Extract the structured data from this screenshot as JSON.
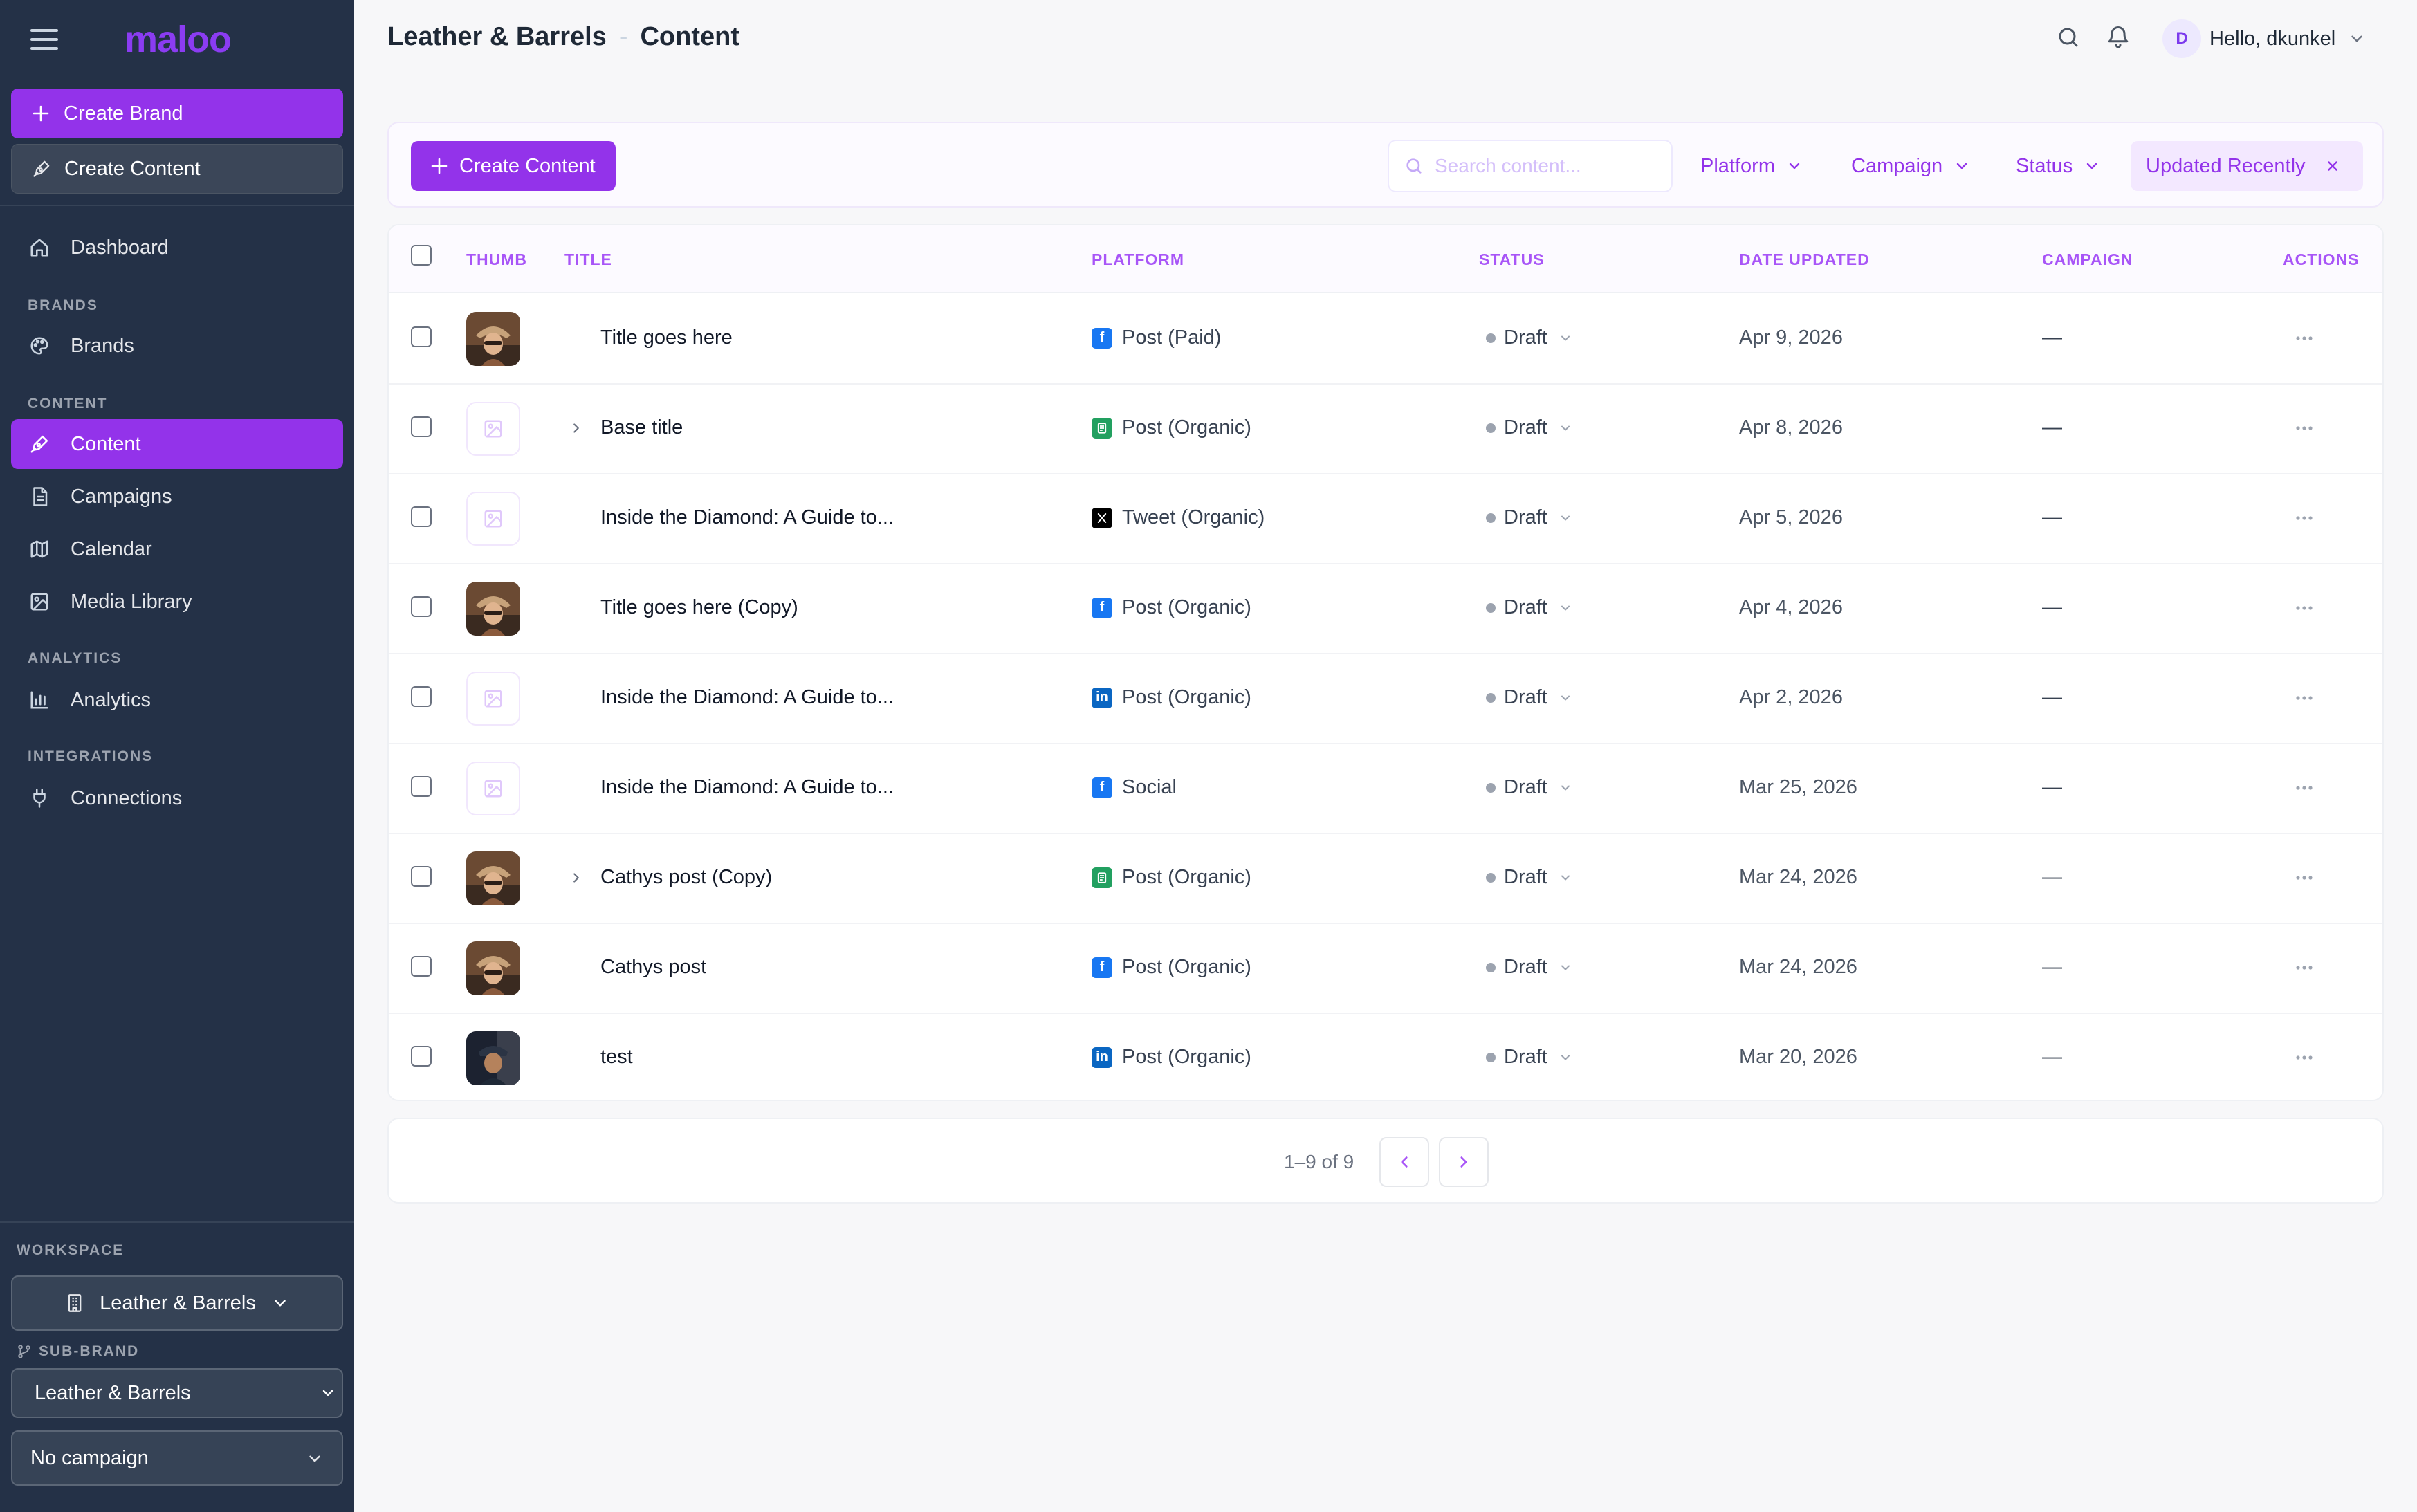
{
  "sidebar": {
    "logo": "maloo",
    "create_brand": "Create Brand",
    "create_content": "Create Content",
    "dashboard": "Dashboard",
    "section_brands": "BRANDS",
    "brands": "Brands",
    "section_content": "CONTENT",
    "content": "Content",
    "campaigns": "Campaigns",
    "calendar": "Calendar",
    "media_library": "Media Library",
    "section_analytics": "ANALYTICS",
    "analytics": "Analytics",
    "section_integrations": "INTEGRATIONS",
    "connections": "Connections",
    "workspace_label": "WORKSPACE",
    "workspace_value": "Leather & Barrels",
    "subbrand_label": "SUB-BRAND",
    "subbrand_value": "Leather & Barrels",
    "campaign_value": "No campaign"
  },
  "header": {
    "brand": "Leather & Barrels",
    "separator": "-",
    "page": "Content",
    "user_initial": "D",
    "greeting": "Hello, dkunkel"
  },
  "toolbar": {
    "create_label": "Create Content",
    "search_placeholder": "Search content...",
    "filter_platform": "Platform",
    "filter_campaign": "Campaign",
    "filter_status": "Status",
    "filter_updated": "Updated Recently"
  },
  "table": {
    "columns": {
      "thumb": "THUMB",
      "title": "TITLE",
      "platform": "PLATFORM",
      "status": "STATUS",
      "date": "DATE UPDATED",
      "campaign": "CAMPAIGN",
      "actions": "ACTIONS"
    },
    "rows": [
      {
        "thumb": "photo-a",
        "expandable": false,
        "title": "Title goes here",
        "platform_icon": "facebook",
        "platform": "Post (Paid)",
        "status": "Draft",
        "date": "Apr 9, 2026",
        "campaign": "—"
      },
      {
        "thumb": "placeholder",
        "expandable": true,
        "title": "Base title",
        "platform_icon": "generic",
        "platform": "Post (Organic)",
        "status": "Draft",
        "date": "Apr 8, 2026",
        "campaign": "—"
      },
      {
        "thumb": "placeholder",
        "expandable": false,
        "title": "Inside the Diamond: A Guide to...",
        "platform_icon": "x",
        "platform": "Tweet (Organic)",
        "status": "Draft",
        "date": "Apr 5, 2026",
        "campaign": "—"
      },
      {
        "thumb": "photo-a",
        "expandable": false,
        "title": "Title goes here (Copy)",
        "platform_icon": "facebook",
        "platform": "Post (Organic)",
        "status": "Draft",
        "date": "Apr 4, 2026",
        "campaign": "—"
      },
      {
        "thumb": "placeholder",
        "expandable": false,
        "title": "Inside the Diamond: A Guide to...",
        "platform_icon": "linkedin",
        "platform": "Post (Organic)",
        "status": "Draft",
        "date": "Apr 2, 2026",
        "campaign": "—"
      },
      {
        "thumb": "placeholder",
        "expandable": false,
        "title": "Inside the Diamond: A Guide to...",
        "platform_icon": "facebook",
        "platform": "Social",
        "status": "Draft",
        "date": "Mar 25, 2026",
        "campaign": "—"
      },
      {
        "thumb": "photo-a",
        "expandable": true,
        "title": "Cathys post (Copy)",
        "platform_icon": "generic",
        "platform": "Post (Organic)",
        "status": "Draft",
        "date": "Mar 24, 2026",
        "campaign": "—"
      },
      {
        "thumb": "photo-a",
        "expandable": false,
        "title": "Cathys post",
        "platform_icon": "facebook",
        "platform": "Post (Organic)",
        "status": "Draft",
        "date": "Mar 24, 2026",
        "campaign": "—"
      },
      {
        "thumb": "photo-b",
        "expandable": false,
        "title": "test",
        "platform_icon": "linkedin",
        "platform": "Post (Organic)",
        "status": "Draft",
        "date": "Mar 20, 2026",
        "campaign": "—"
      }
    ]
  },
  "pagination": {
    "text": "1–9 of 9"
  },
  "colors": {
    "accent": "#9333ea",
    "sidebar_bg": "#243147",
    "facebook": "#1877f2",
    "linkedin": "#0a66c2",
    "generic": "#22a060"
  }
}
